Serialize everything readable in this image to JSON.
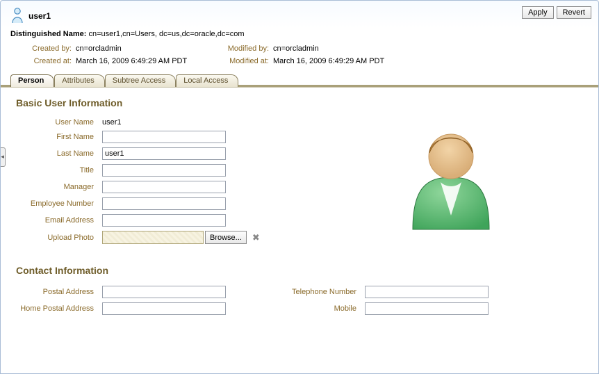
{
  "header": {
    "title": "user1",
    "apply_label": "Apply",
    "revert_label": "Revert"
  },
  "dn": {
    "label": "Distinguished Name:",
    "value": "cn=user1,cn=Users, dc=us,dc=oracle,dc=com"
  },
  "meta": {
    "created_by_label": "Created by:",
    "created_by_value": "cn=orcladmin",
    "created_at_label": "Created at:",
    "created_at_value": "March 16, 2009 6:49:29 AM PDT",
    "modified_by_label": "Modified by:",
    "modified_by_value": "cn=orcladmin",
    "modified_at_label": "Modified at:",
    "modified_at_value": "March 16, 2009 6:49:29 AM PDT"
  },
  "tabs": {
    "person": "Person",
    "attributes": "Attributes",
    "subtree_access": "Subtree Access",
    "local_access": "Local Access"
  },
  "sections": {
    "basic": "Basic User Information",
    "contact": "Contact Information"
  },
  "labels": {
    "user_name": "User Name",
    "first_name": "First Name",
    "last_name": "Last Name",
    "title": "Title",
    "manager": "Manager",
    "employee_number": "Employee Number",
    "email_address": "Email Address",
    "upload_photo": "Upload Photo",
    "browse": "Browse...",
    "postal_address": "Postal Address",
    "home_postal_address": "Home Postal Address",
    "telephone_number": "Telephone Number",
    "mobile": "Mobile"
  },
  "values": {
    "user_name": "user1",
    "first_name": "",
    "last_name": "user1",
    "title": "",
    "manager": "",
    "employee_number": "",
    "email_address": "",
    "postal_address": "",
    "home_postal_address": "",
    "telephone_number": "",
    "mobile": ""
  },
  "icons": {
    "user_small": "user-icon",
    "avatar_large": "user-avatar-icon",
    "clear_photo": "close-icon",
    "expander": "expand-handle-icon"
  }
}
